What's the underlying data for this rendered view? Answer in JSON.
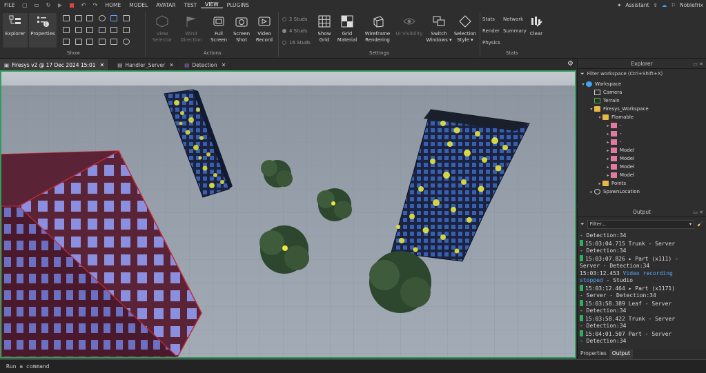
{
  "menubar": {
    "items": [
      "FILE",
      "HOME",
      "MODEL",
      "AVATAR",
      "TEST",
      "VIEW",
      "PLUGINS"
    ],
    "assistant": "Assistant",
    "user": "Noblefrix"
  },
  "ribbon": {
    "explorer": "Explorer",
    "properties": "Properties",
    "show_group": "Show",
    "view_selector": [
      "View",
      "Selector"
    ],
    "wind_direction": [
      "Wind",
      "Direction"
    ],
    "full_screen": [
      "Full",
      "Screen"
    ],
    "screen_shot": [
      "Screen",
      "Shot"
    ],
    "video_record": [
      "Video",
      "Record"
    ],
    "actions_group": "Actions",
    "studs": [
      "2 Studs",
      "4 Studs",
      "16 Studs"
    ],
    "show_grid": [
      "Show",
      "Grid"
    ],
    "grid_material": [
      "Grid",
      "Material"
    ],
    "wireframe": [
      "Wireframe",
      "Rendering"
    ],
    "ui_visibility": "UI Visibility",
    "switch_windows": [
      "Switch",
      "Windows ▾"
    ],
    "selection_style": [
      "Selection",
      "Style ▾"
    ],
    "settings_group": "Settings",
    "stats": "Stats",
    "network": "Network",
    "render": "Render",
    "summary": "Summary",
    "physics": "Physics",
    "clear": "Clear",
    "stats_group": "Stats"
  },
  "tabs": [
    {
      "label": "Firesys v2 @ 17 Dec 2024 15:01"
    },
    {
      "label": "Handler_Server"
    },
    {
      "label": "Detection"
    }
  ],
  "explorer": {
    "title": "Explorer",
    "filter_placeholder": "Filter workspace (Ctrl+Shift+X)",
    "items": [
      "Workspace",
      "Camera",
      "Terrain",
      "Firesys_Workspace",
      "Flamable",
      "-",
      "-",
      "-",
      "Model",
      "Model",
      "Model",
      "Model",
      "Points",
      "SpawnLocation"
    ]
  },
  "output": {
    "title": "Output",
    "filter_placeholder": "Filter...",
    "lines": [
      {
        "bar": false,
        "text": "- Detection:34"
      },
      {
        "bar": true,
        "text": "15:03:04.715  Trunk  -  Server"
      },
      {
        "bar": false,
        "text": "- Detection:34"
      },
      {
        "bar": true,
        "text": "15:03:07.826  ▸ Part (x111)  -"
      },
      {
        "bar": false,
        "text": "Server - Detection:34"
      },
      {
        "bar": false,
        "text": "  15:03:12.453  ",
        "blue": "Video recording"
      },
      {
        "bar": false,
        "blue2": "stopped",
        "text2": "  -  Studio"
      },
      {
        "bar": true,
        "text": "15:03:12.464  ▸ Part (x1171)"
      },
      {
        "bar": false,
        "text": "-  Server - Detection:34"
      },
      {
        "bar": true,
        "text": "15:03:58.389  Leaf  -  Server"
      },
      {
        "bar": false,
        "text": "- Detection:34"
      },
      {
        "bar": true,
        "text": "15:03:58.422  Trunk  -  Server"
      },
      {
        "bar": false,
        "text": "- Detection:34"
      },
      {
        "bar": true,
        "text": "15:04:01.507  Part  -  Server"
      },
      {
        "bar": false,
        "text": "- Detection:34"
      }
    ],
    "bottom_tabs": [
      "Properties",
      "Output"
    ]
  },
  "command": {
    "placeholder": "Run a command"
  }
}
